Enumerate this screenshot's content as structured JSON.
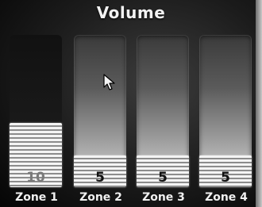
{
  "header": {
    "title": "Volume"
  },
  "zones": [
    {
      "label": "Zone 1",
      "level": "10",
      "fill": 0.44
    },
    {
      "label": "Zone 2",
      "level": "5",
      "fill": 0.22
    },
    {
      "label": "Zone 3",
      "level": "5",
      "fill": 0.22
    },
    {
      "label": "Zone 4",
      "level": "5",
      "fill": 0.22
    }
  ]
}
